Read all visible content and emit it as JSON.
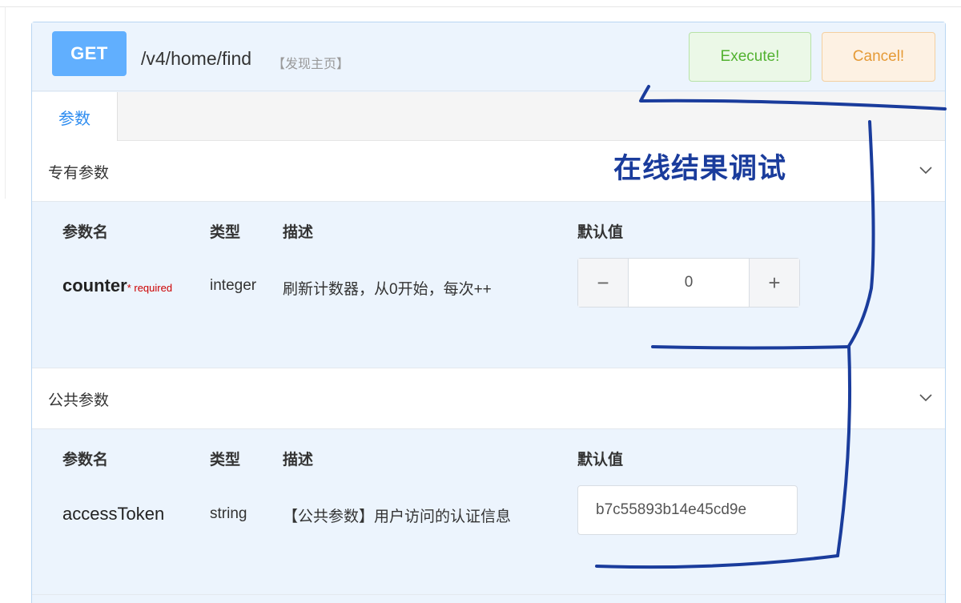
{
  "endpoint": {
    "method": "GET",
    "path": "/v4/home/find",
    "summary": "【发现主页】",
    "execute_label": "Execute!",
    "cancel_label": "Cancel!"
  },
  "tabs": [
    {
      "label": "参数",
      "active": true
    }
  ],
  "sections": [
    {
      "title": "专有参数",
      "columns": {
        "name": "参数名",
        "type": "类型",
        "desc": "描述",
        "default": "默认值"
      },
      "param": {
        "name": "counter",
        "required_mark": "* required",
        "type": "integer",
        "desc": "刷新计数器，从0开始，每次++",
        "value": "0",
        "minus": "−",
        "plus": "+"
      }
    },
    {
      "title": "公共参数",
      "columns": {
        "name": "参数名",
        "type": "类型",
        "desc": "描述",
        "default": "默认值"
      },
      "param": {
        "name": "accessToken",
        "type": "string",
        "desc": "【公共参数】用户访问的认证信息",
        "value": "b7c55893b14e45cd9e"
      }
    }
  ],
  "annotation": {
    "text": "在线结果调试",
    "color": "#1a3c9c"
  },
  "icons": {
    "chevron": "chevron-down-icon",
    "minus": "minus-icon",
    "plus": "plus-icon"
  },
  "colors": {
    "get_badge": "#61affe",
    "execute": "#52b230",
    "cancel": "#e59a36",
    "tab_active": "#2d8cf0",
    "required": "#cc0000"
  }
}
